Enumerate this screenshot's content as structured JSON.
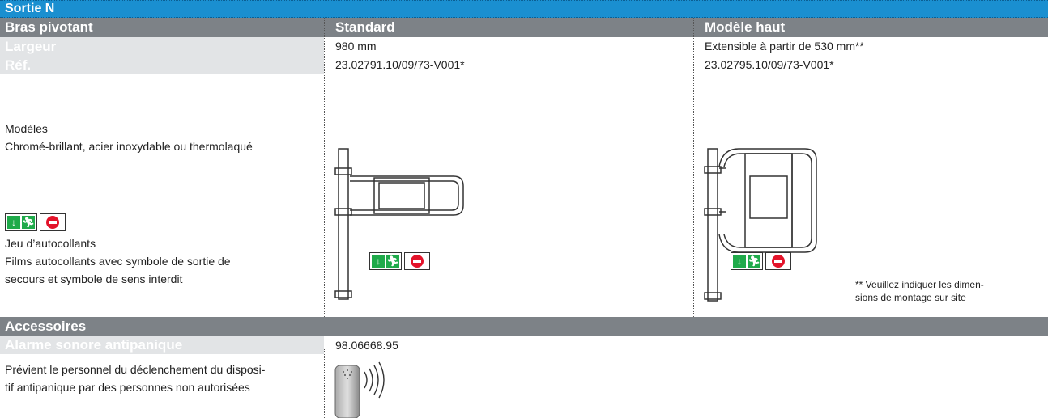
{
  "title": "Sortie N",
  "columns": {
    "col1": "Bras pivotant",
    "col2": "Standard",
    "col3": "Modèle haut"
  },
  "specs": {
    "largeur_label": "Largeur",
    "largeur_standard": "980 mm",
    "largeur_haut": "Extensible à partir de 530 mm**",
    "ref_label": "Réf.",
    "ref_standard": "23.02791.10/09/73-V001*",
    "ref_haut": "23.02795.10/09/73-V001*"
  },
  "models": {
    "heading": "Modèles",
    "finishes": "Chromé-brillant, acier inoxydable ou thermolaqué"
  },
  "stickers": {
    "heading": "Jeu d’autocollants",
    "line1": "Films autocollants avec symbole de sortie de",
    "line2": "secours et symbole de sens interdit"
  },
  "footnote": {
    "line1": "** Veuillez indiquer les dimen-",
    "line2": "sions de montage sur site"
  },
  "accessories": {
    "heading": "Accessoires",
    "alarm_label": "Alarme sonore antipanique",
    "alarm_ref": "98.06668.95",
    "desc_line1": "Prévient le personnel du déclenchement du disposi-",
    "desc_line2": "tif antipanique par des personnes non autorisées"
  },
  "colors": {
    "title_bar": "#1a8fd0",
    "header_bar": "#7d8287",
    "sub_bar": "#e2e4e6",
    "exit_green": "#1faa4a",
    "no_entry_red": "#e3132a"
  }
}
